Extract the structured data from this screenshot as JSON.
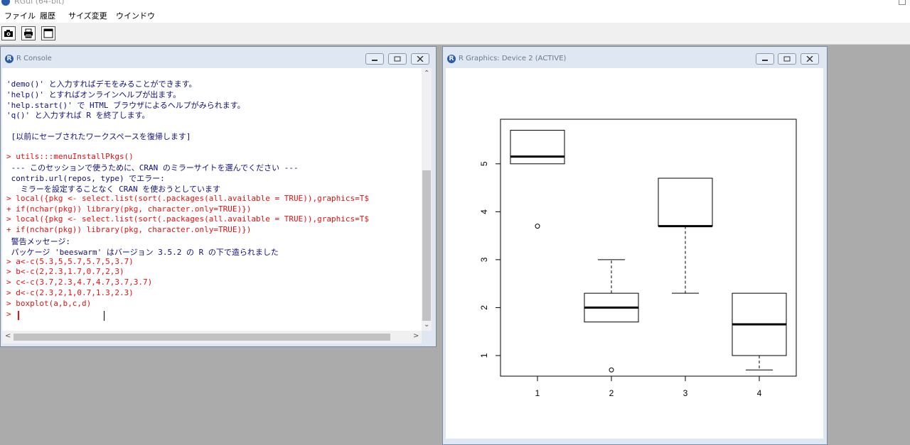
{
  "app": {
    "title": "RGui (64-bit)"
  },
  "menu": [
    "ファイル",
    "履歴",
    "サイズ変更",
    "ウインドウ"
  ],
  "toolbar": {
    "icons": [
      "camera-icon",
      "printer-icon",
      "window-icon"
    ]
  },
  "console": {
    "title": "R Console",
    "lines": [
      {
        "text": "'demo()' と入力すればデモをみることができます。",
        "color": "blue"
      },
      {
        "text": "'help()' とすればオンラインヘルプが出ます。",
        "color": "blue"
      },
      {
        "text": "'help.start()' で HTML ブラウザによるヘルプがみられます。",
        "color": "blue"
      },
      {
        "text": "'q()' と入力すれば R を終了します。",
        "color": "blue"
      },
      {
        "text": "",
        "color": "blue"
      },
      {
        "text": " [以前にセーブされたワークスペースを復帰します]",
        "color": "blue"
      },
      {
        "text": "",
        "color": "blue"
      },
      {
        "text": "> utils:::menuInstallPkgs()",
        "color": "red"
      },
      {
        "text": " --- このセッションで使うために、CRAN のミラーサイトを選んでください ---",
        "color": "blue"
      },
      {
        "text": " contrib.url(repos, type) でエラー:",
        "color": "blue"
      },
      {
        "text": "   ミラーを設定することなく CRAN を使おうとしています",
        "color": "blue"
      },
      {
        "text": "> local({pkg <- select.list(sort(.packages(all.available = TRUE)),graphics=T$",
        "color": "red"
      },
      {
        "text": "+ if(nchar(pkg)) library(pkg, character.only=TRUE)})",
        "color": "red"
      },
      {
        "text": "> local({pkg <- select.list(sort(.packages(all.available = TRUE)),graphics=T$",
        "color": "red"
      },
      {
        "text": "+ if(nchar(pkg)) library(pkg, character.only=TRUE)})",
        "color": "red"
      },
      {
        "text": " 警告メッセージ:",
        "color": "blue"
      },
      {
        "text": " パッケージ 'beeswarm' はバージョン 3.5.2 の R の下で造られました",
        "color": "blue"
      },
      {
        "text": "> a<-c(5.3,5,5.7,5.7,5,3.7)",
        "color": "red"
      },
      {
        "text": "> b<-c(2,2.3,1.7,0.7,2,3)",
        "color": "red"
      },
      {
        "text": "> c<-c(3.7,2.3,4.7,4.7,3.7,3.7)",
        "color": "red"
      },
      {
        "text": "> d<-c(2.3,2,1,0.7,1.3,2.3)",
        "color": "red"
      },
      {
        "text": "> boxplot(a,b,c,d)",
        "color": "red"
      },
      {
        "text": "> ",
        "color": "red"
      }
    ]
  },
  "graphics": {
    "title": "R Graphics: Device 2 (ACTIVE)"
  },
  "chart_data": {
    "type": "boxplot",
    "categories": [
      "1",
      "2",
      "3",
      "4"
    ],
    "boxes": [
      {
        "lower_whisker": 5.0,
        "q1": 5.0,
        "median": 5.15,
        "q3": 5.7,
        "upper_whisker": 5.7,
        "outliers": [
          3.7
        ]
      },
      {
        "lower_whisker": 1.7,
        "q1": 1.7,
        "median": 2.0,
        "q3": 2.3,
        "upper_whisker": 3.0,
        "outliers": [
          0.7
        ]
      },
      {
        "lower_whisker": 2.3,
        "q1": 3.7,
        "median": 3.7,
        "q3": 4.7,
        "upper_whisker": 4.7,
        "outliers": []
      },
      {
        "lower_whisker": 0.7,
        "q1": 1.0,
        "median": 1.65,
        "q3": 2.3,
        "upper_whisker": 2.3,
        "outliers": []
      }
    ],
    "yticks": [
      "1",
      "2",
      "3",
      "4",
      "5"
    ],
    "ylim": [
      0.57,
      5.93
    ]
  }
}
